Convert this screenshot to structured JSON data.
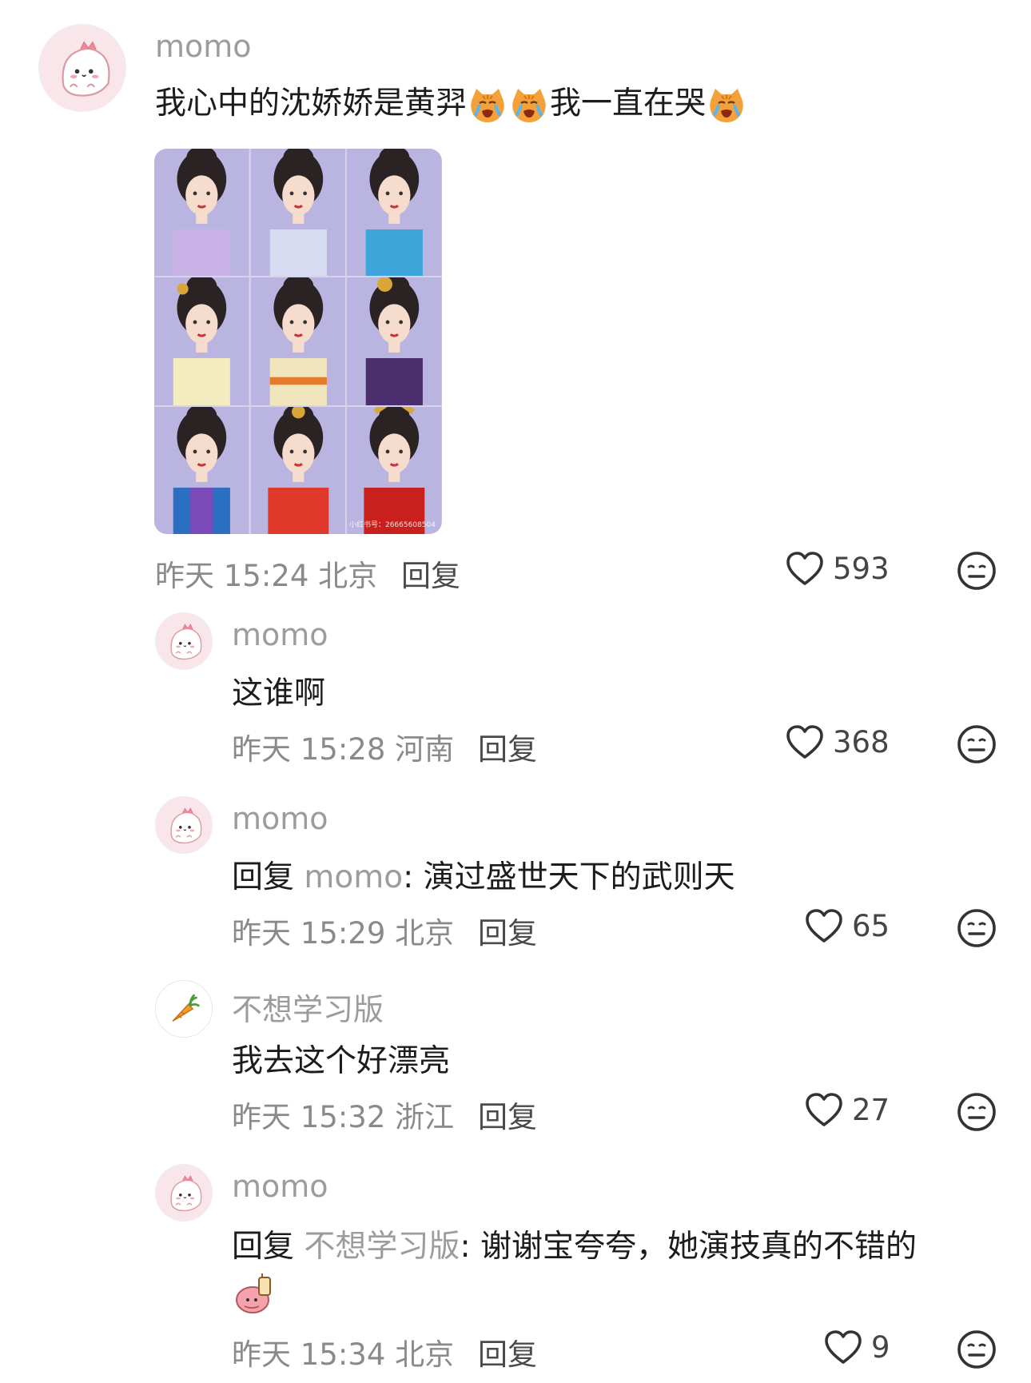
{
  "comments": [
    {
      "username": "momo",
      "text_before": "我心中的沈娇娇是黄羿",
      "text_middle": "我一直在哭",
      "time": "昨天 15:24",
      "location": "北京",
      "reply_label": "回复",
      "likes": "593",
      "image_watermark": "小红书号：26665608504"
    },
    {
      "username": "momo",
      "text": "这谁啊",
      "time": "昨天 15:28",
      "location": "河南",
      "reply_label": "回复",
      "likes": "368"
    },
    {
      "username": "momo",
      "reply_prefix": "回复",
      "reply_to": "momo",
      "text": ": 演过盛世天下的武则天",
      "time": "昨天 15:29",
      "location": "北京",
      "reply_label": "回复",
      "likes": "65"
    },
    {
      "username": "不想学习版",
      "text": "我去这个好漂亮",
      "time": "昨天 15:32",
      "location": "浙江",
      "reply_label": "回复",
      "likes": "27"
    },
    {
      "username": "momo",
      "reply_prefix": "回复",
      "reply_to": "不想学习版",
      "text": ": 谢谢宝夸夸，她演技真的不错的",
      "time": "昨天 15:34",
      "location": "北京",
      "reply_label": "回复",
      "likes": "9"
    }
  ],
  "icons": {
    "avatar_pink": "pink-dino-avatar",
    "avatar_carrot": "carrot-avatar",
    "crying_cat": "crying-cat-emoji",
    "like": "heart-outline-icon",
    "more": "neutral-face-icon"
  },
  "colors": {
    "username": "#9c9c9c",
    "meta": "#8a8a8a",
    "text": "#1c1c1c"
  }
}
